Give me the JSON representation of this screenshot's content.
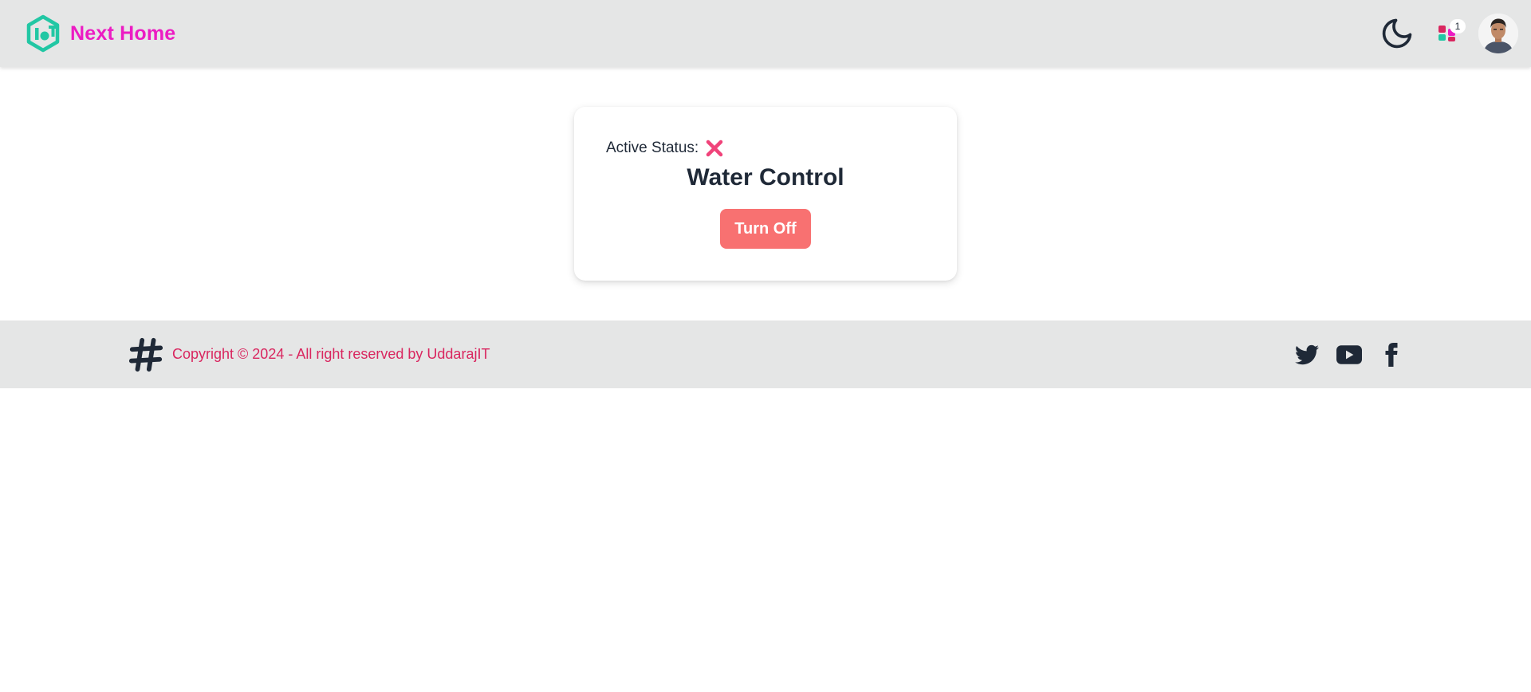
{
  "navbar": {
    "brand_name": "Next Home",
    "notifications_count": "1",
    "icons": [
      "iot-logo-icon",
      "moon-icon",
      "apps-icon",
      "avatar"
    ]
  },
  "card": {
    "status_label": "Active Status:",
    "status_icon": "x-mark-icon",
    "title": "Water Control",
    "button_label": "Turn Off"
  },
  "footer": {
    "copyright": "Copyright © 2024 - All right reserved by UddarajIT",
    "icons": [
      "hashtag-icon",
      "twitter-icon",
      "youtube-icon",
      "facebook-icon"
    ]
  },
  "colors": {
    "brand": "#ec1cc3",
    "logo": "#22c7a4",
    "bar_bg": "#e5e6e6",
    "button": "#f87171",
    "status_x": "#f0437a",
    "footer_text": "#d9265f",
    "dark": "#1f2937"
  }
}
